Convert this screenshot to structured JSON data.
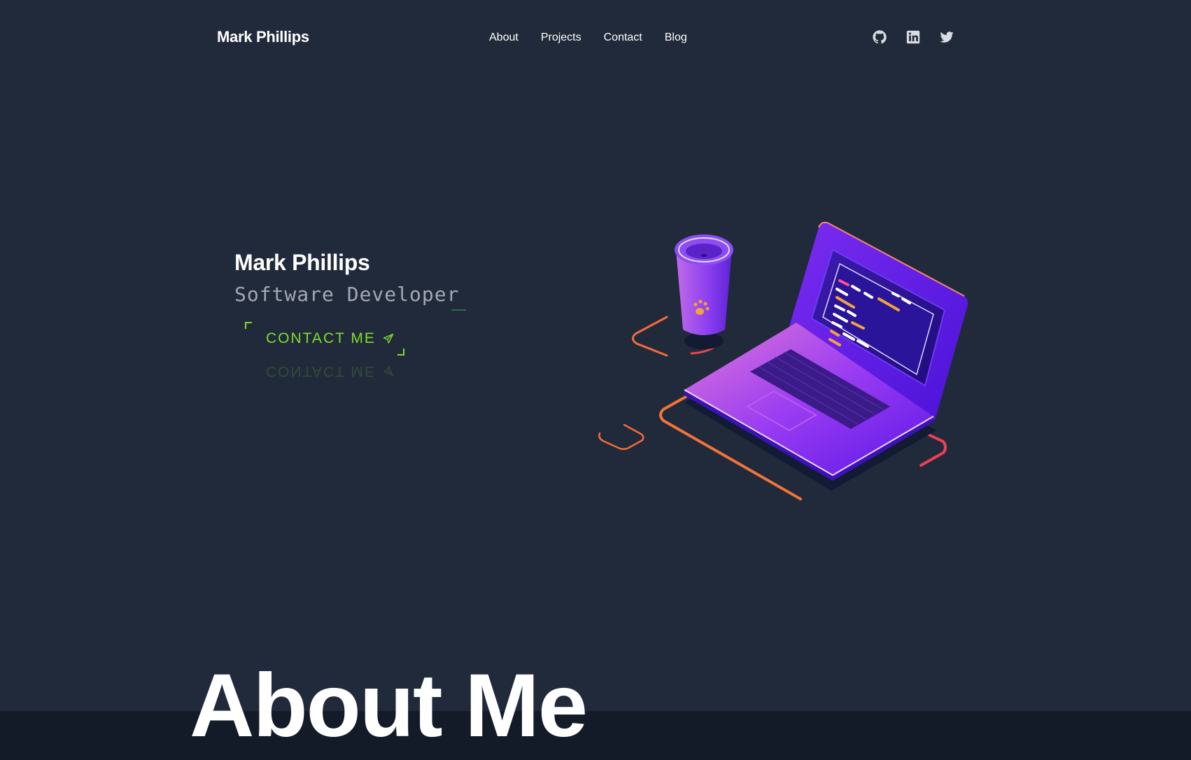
{
  "nav": {
    "brand": "Mark Phillips",
    "links": [
      "About",
      "Projects",
      "Contact",
      "Blog"
    ],
    "social": [
      "github-icon",
      "linkedin-icon",
      "twitter-icon"
    ]
  },
  "hero": {
    "name": "Mark Phillips",
    "role": "Software Developer",
    "cta_label": "CONTACT ME",
    "cta_icon": "send-icon",
    "illustration": "laptop-coffee-illustration"
  },
  "about": {
    "title": "About Me"
  },
  "colors": {
    "background": "#212a3a",
    "accent": "#7fdc2f",
    "band": "#131a28"
  }
}
